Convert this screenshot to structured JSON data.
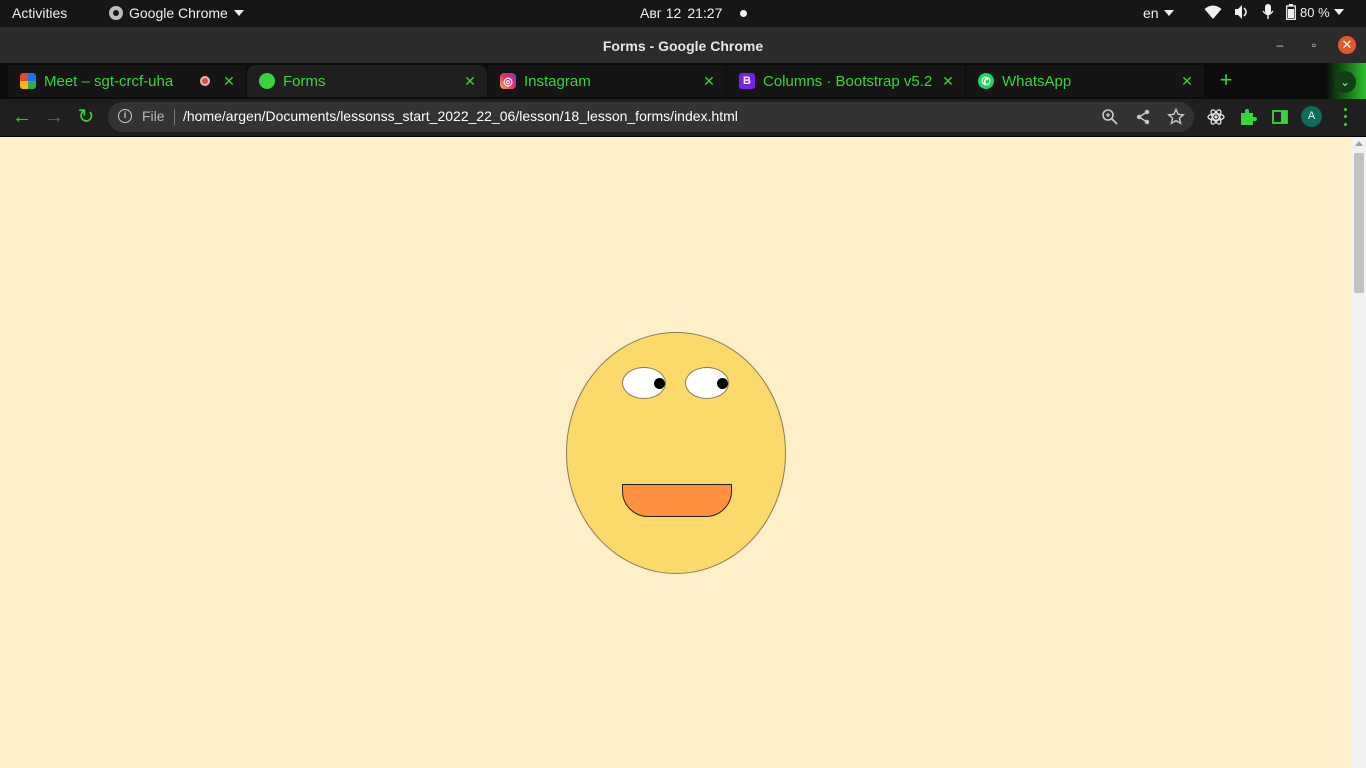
{
  "system_bar": {
    "activities": "Activities",
    "app_name": "Google Chrome",
    "date": "Авг 12",
    "time": "21:27",
    "language": "en",
    "battery": "80 %"
  },
  "window": {
    "title": "Forms - Google Chrome"
  },
  "tabs": [
    {
      "label": "Meet – sgt-crcf-uha",
      "favicon": "google-meet-icon",
      "recording": true,
      "active": false
    },
    {
      "label": "Forms",
      "favicon": "globe-icon",
      "active": true
    },
    {
      "label": "Instagram",
      "favicon": "instagram-icon",
      "active": false
    },
    {
      "label": "Columns · Bootstrap v5.2",
      "favicon": "bootstrap-icon",
      "active": false
    },
    {
      "label": "WhatsApp",
      "favicon": "whatsapp-icon",
      "active": false
    }
  ],
  "toolbar": {
    "scheme_label": "File",
    "url": "/home/argen/Documents/lessonss_start_2022_22_06/lesson/18_lesson_forms/index.html",
    "profile_initial": "A"
  },
  "colors": {
    "accent_green": "#39d43c",
    "page_background": "#fdefc9",
    "face": "#fbd96b",
    "mouth": "#ff903f"
  }
}
